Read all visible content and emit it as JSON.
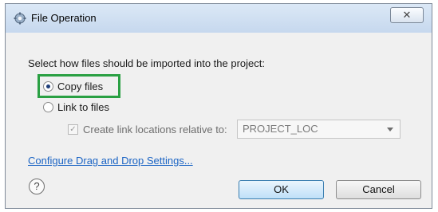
{
  "window": {
    "title": "File Operation",
    "close_label": "✕"
  },
  "content": {
    "prompt": "Select how files should be imported into the project:",
    "options": [
      {
        "label": "Copy files",
        "selected": true
      },
      {
        "label": "Link to files",
        "selected": false
      }
    ],
    "checkbox": {
      "label": "Create link locations relative to:",
      "checked": true,
      "enabled": false
    },
    "select": {
      "value": "PROJECT_LOC"
    },
    "link_text": "Configure Drag and Drop Settings..."
  },
  "footer": {
    "help_label": "?",
    "ok_label": "OK",
    "cancel_label": "Cancel"
  },
  "colors": {
    "highlight": "#2aa043",
    "link": "#1b64c4"
  }
}
